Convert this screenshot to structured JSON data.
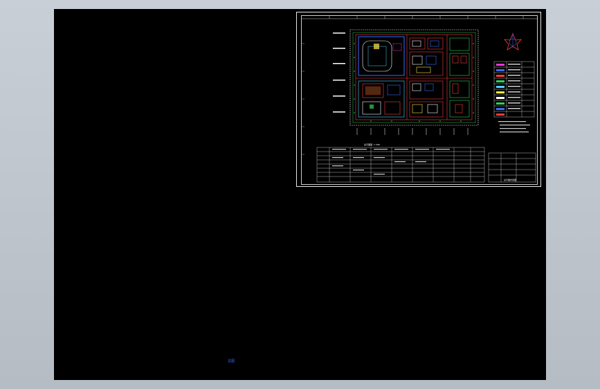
{
  "canvas": {
    "background": "#000000",
    "workspace_color": "#bfc5cd"
  },
  "drawing": {
    "plan_caption": "总平面图 1:500",
    "title_block_name": "总平面布置图",
    "stray_text": "总图"
  },
  "colors": {
    "frame": "#e8e8e8",
    "road_red": "#ff3b3b",
    "green": "#2fd05a",
    "blue": "#3a6cff",
    "cyan": "#4fd4ff",
    "yellow": "#ffe84a",
    "magenta": "#e83ad2",
    "white": "#ffffff"
  },
  "icons": {
    "north_arrow": "north-arrow-icon"
  }
}
